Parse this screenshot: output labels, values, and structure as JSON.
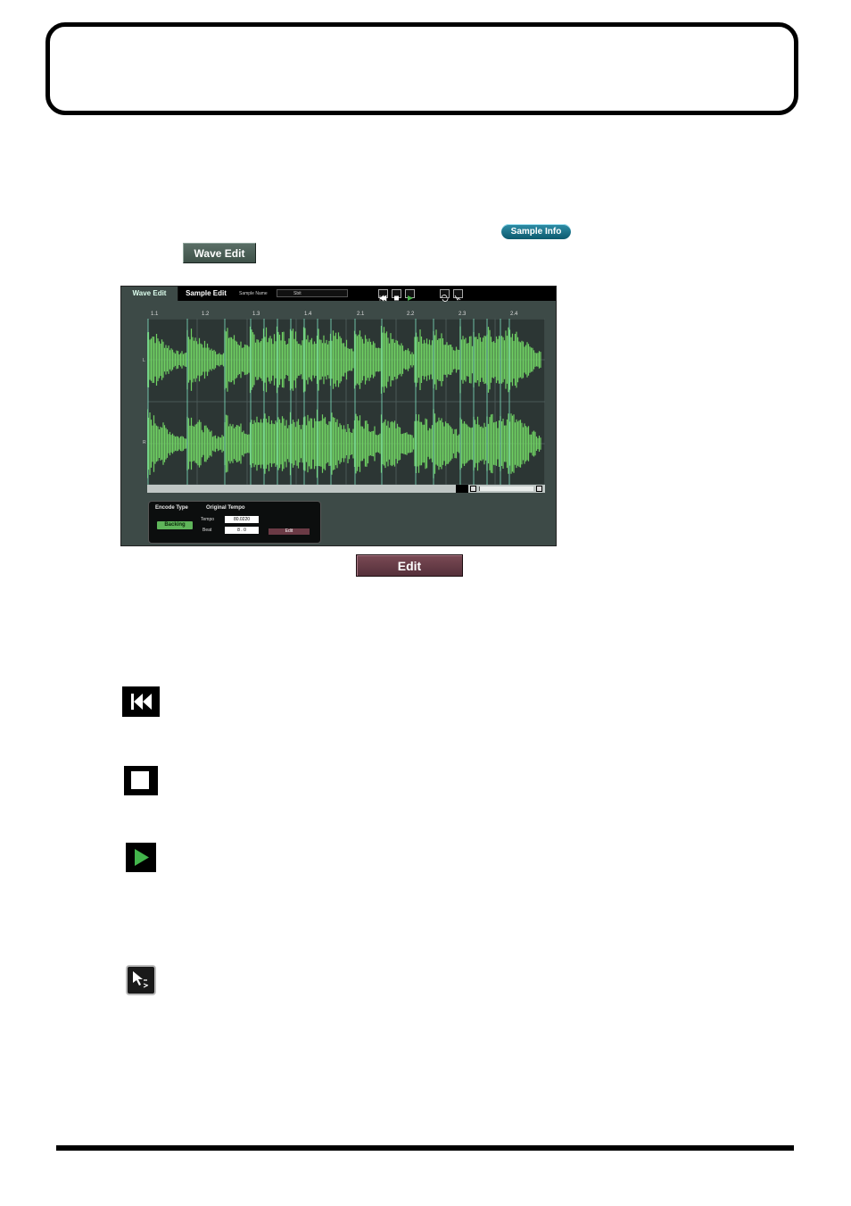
{
  "buttons": {
    "sample_info": "Sample Info",
    "wave_edit": "Wave Edit",
    "edit": "Edit"
  },
  "screenshot": {
    "tabs": [
      "Wave Edit",
      "Sample Edit"
    ],
    "sample_name_label": "Sample Name",
    "sample_name_value": "Sbit",
    "ruler": [
      "1.1",
      "1.2",
      "1.3",
      "1.4",
      "2.1",
      "2.2",
      "2.3",
      "2.4"
    ],
    "channels": [
      "L",
      "R"
    ],
    "panel": {
      "encode_type_label": "Encode Type",
      "encode_type_value": "Backing",
      "original_tempo_label": "Original Tempo",
      "tempo_label": "Tempo",
      "tempo_value": "80.0220",
      "beat_label": "Beat",
      "beat_value": "8 . 0",
      "edit_label": "Edit"
    }
  },
  "icons": [
    "rewind-icon",
    "stop-icon",
    "play-icon",
    "select-sound-icon"
  ],
  "colors": {
    "waveform": "#6fcf63",
    "sample_info_button": "#1c7a91",
    "wave_edit_button": "#4d6259",
    "edit_button": "#6b3f49"
  }
}
